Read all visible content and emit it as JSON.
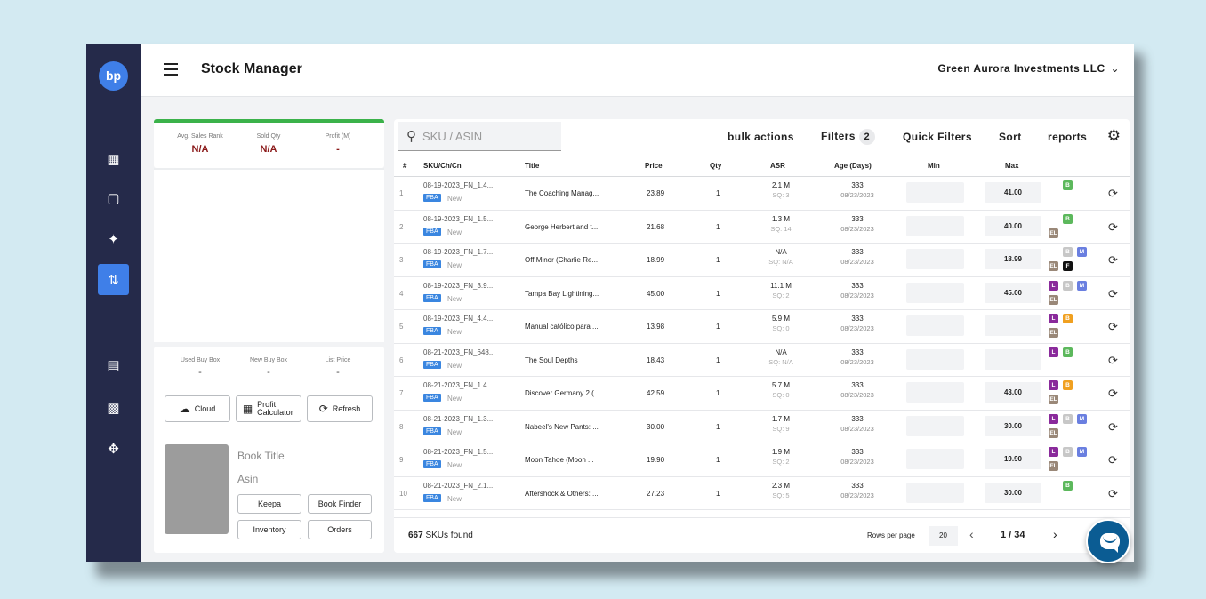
{
  "app": {
    "title": "Stock Manager",
    "company": "Green Aurora Investments LLC",
    "logo": "bp"
  },
  "rail": {
    "icons": [
      "dashboard-icon",
      "box-icon",
      "magic-wand-icon",
      "sort-icon",
      "receipt-icon",
      "money-icon",
      "move-icon"
    ],
    "active": "sort-icon"
  },
  "stats": {
    "avg_sales_rank": {
      "label": "Avg. Sales Rank",
      "value": "N/A"
    },
    "sold_qty": {
      "label": "Sold Qty",
      "value": "N/A"
    },
    "profit": {
      "label": "Profit (M)",
      "value": "-"
    }
  },
  "buybox": {
    "used": {
      "label": "Used Buy Box",
      "value": "-"
    },
    "new": {
      "label": "New Buy Box",
      "value": "-"
    },
    "list": {
      "label": "List Price",
      "value": "-"
    }
  },
  "tools": {
    "cloud": "Cloud",
    "profit_calc": "Profit Calculator",
    "refresh": "Refresh"
  },
  "book": {
    "title": "Book Title",
    "asin": "Asin",
    "keepa": "Keepa",
    "book_finder": "Book Finder",
    "inventory": "Inventory",
    "orders": "Orders"
  },
  "toolbar": {
    "search_placeholder": "SKU / ASIN",
    "bulk": "bulk actions",
    "filters": "Filters",
    "filters_count": "2",
    "quick": "Quick Filters",
    "sort": "Sort",
    "reports": "reports"
  },
  "columns": {
    "num": "#",
    "sku": "SKU/Ch/Cn",
    "title": "Title",
    "price": "Price",
    "qty": "Qty",
    "asr": "ASR",
    "age": "Age (Days)",
    "min": "Min",
    "max": "Max"
  },
  "rows": [
    {
      "num": "1",
      "sku": "08-19-2023_FN_1.4...",
      "channel": "FBA",
      "cond": "New",
      "title": "The Coaching Manag...",
      "price": "23.89",
      "qty": "1",
      "asr": "2.1 M",
      "sq": "SQ: 3",
      "age": "333",
      "date": "08/23/2023",
      "max": "41.00",
      "tags": [
        "B"
      ]
    },
    {
      "num": "2",
      "sku": "08-19-2023_FN_1.5...",
      "channel": "FBA",
      "cond": "New",
      "title": "George Herbert and t...",
      "price": "21.68",
      "qty": "1",
      "asr": "1.3 M",
      "sq": "SQ: 14",
      "age": "333",
      "date": "08/23/2023",
      "max": "40.00",
      "tags": [
        "B",
        "EL"
      ]
    },
    {
      "num": "3",
      "sku": "08-19-2023_FN_1.7...",
      "channel": "FBA",
      "cond": "New",
      "title": "Off Minor (Charlie Re...",
      "price": "18.99",
      "qty": "1",
      "asr": "N/A",
      "sq": "SQ: N/A",
      "age": "333",
      "date": "08/23/2023",
      "max": "18.99",
      "tags": [
        "B",
        "M",
        "EL",
        "F"
      ]
    },
    {
      "num": "4",
      "sku": "08-19-2023_FN_3.9...",
      "channel": "FBA",
      "cond": "New",
      "title": "Tampa Bay Lightining...",
      "price": "45.00",
      "qty": "1",
      "asr": "11.1 M",
      "sq": "SQ: 2",
      "age": "333",
      "date": "08/23/2023",
      "max": "45.00",
      "tags": [
        "L",
        "B",
        "M",
        "EL"
      ]
    },
    {
      "num": "5",
      "sku": "08-19-2023_FN_4.4...",
      "channel": "FBA",
      "cond": "New",
      "title": "Manual católico para ...",
      "price": "13.98",
      "qty": "1",
      "asr": "5.9 M",
      "sq": "SQ: 0",
      "age": "333",
      "date": "08/23/2023",
      "max": "",
      "tags": [
        "L",
        "B",
        "EL"
      ]
    },
    {
      "num": "6",
      "sku": "08-21-2023_FN_648...",
      "channel": "FBA",
      "cond": "New",
      "title": "The Soul Depths",
      "price": "18.43",
      "qty": "1",
      "asr": "N/A",
      "sq": "SQ: N/A",
      "age": "333",
      "date": "08/23/2023",
      "max": "",
      "tags": [
        "L",
        "B"
      ]
    },
    {
      "num": "7",
      "sku": "08-21-2023_FN_1.4...",
      "channel": "FBA",
      "cond": "New",
      "title": "Discover Germany 2 (...",
      "price": "42.59",
      "qty": "1",
      "asr": "5.7 M",
      "sq": "SQ: 0",
      "age": "333",
      "date": "08/23/2023",
      "max": "43.00",
      "tags": [
        "L",
        "B",
        "EL"
      ]
    },
    {
      "num": "8",
      "sku": "08-21-2023_FN_1.3...",
      "channel": "FBA",
      "cond": "New",
      "title": "Nabeel's New Pants: ...",
      "price": "30.00",
      "qty": "1",
      "asr": "1.7 M",
      "sq": "SQ: 9",
      "age": "333",
      "date": "08/23/2023",
      "max": "30.00",
      "tags": [
        "L",
        "B",
        "M",
        "EL"
      ]
    },
    {
      "num": "9",
      "sku": "08-21-2023_FN_1.5...",
      "channel": "FBA",
      "cond": "New",
      "title": "Moon Tahoe (Moon ...",
      "price": "19.90",
      "qty": "1",
      "asr": "1.9 M",
      "sq": "SQ: 2",
      "age": "333",
      "date": "08/23/2023",
      "max": "19.90",
      "tags": [
        "L",
        "B",
        "M",
        "EL"
      ]
    },
    {
      "num": "10",
      "sku": "08-21-2023_FN_2.1...",
      "channel": "FBA",
      "cond": "New",
      "title": "Aftershock & Others: ...",
      "price": "27.23",
      "qty": "1",
      "asr": "2.3 M",
      "sq": "SQ: 5",
      "age": "333",
      "date": "08/23/2023",
      "max": "30.00",
      "tags": [
        "B"
      ]
    }
  ],
  "footer": {
    "count": "667",
    "count_label": "SKUs found",
    "rows_per_page_label": "Rows per page",
    "rows_per_page": "20",
    "page": "1 / 34"
  }
}
